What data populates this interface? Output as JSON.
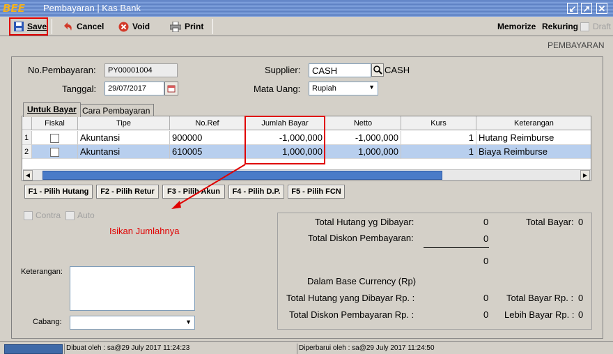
{
  "window": {
    "logo": "BEE",
    "title": "Pembayaran | Kas Bank"
  },
  "toolbar": {
    "save": "Save",
    "cancel": "Cancel",
    "void": "Void",
    "print": "Print",
    "memorize": "Memorize",
    "rekuring": "Rekuring",
    "draft": "Draft"
  },
  "form": {
    "heading": "PEMBAYARAN",
    "no_pembayaran_label": "No.Pembayaran:",
    "no_pembayaran_value": "PY00001004",
    "tanggal_label": "Tanggal:",
    "tanggal_value": "29/07/2017",
    "supplier_label": "Supplier:",
    "supplier_value": "CASH",
    "supplier_name": "CASH",
    "mata_uang_label": "Mata Uang:",
    "mata_uang_value": "Rupiah"
  },
  "tabs": [
    "Untuk Bayar",
    "Cara Pembayaran"
  ],
  "grid": {
    "columns": [
      "Fiskal",
      "Tipe",
      "No.Ref",
      "Jumlah Bayar",
      "Netto",
      "Kurs",
      "Keterangan"
    ],
    "rows": [
      {
        "no": "1",
        "fiskal": false,
        "tipe": "Akuntansi",
        "noref": "900000",
        "jumlah": "-1,000,000",
        "netto": "-1,000,000",
        "kurs": "1",
        "keterangan": "Hutang Reimburse"
      },
      {
        "no": "2",
        "fiskal": false,
        "tipe": "Akuntansi",
        "noref": "610005",
        "jumlah": "1,000,000",
        "netto": "1,000,000",
        "kurs": "1",
        "keterangan": "Biaya Reimburse"
      }
    ]
  },
  "fkeys": [
    "F1 - Pilih Hutang",
    "F2 - Pilih Retur",
    "F3 - Pilih Akun",
    "F4 - Pilih D.P.",
    "F5 - Pilih FCN"
  ],
  "options": {
    "contra": "Contra",
    "auto": "Auto"
  },
  "annotation": "Isikan Jumlahnya",
  "notes": {
    "keterangan_label": "Keterangan:",
    "cabang_label": "Cabang:"
  },
  "totals": {
    "total_hutang_label": "Total Hutang yg Dibayar:",
    "total_hutang_value": "0",
    "total_bayar_label": "Total Bayar:",
    "total_bayar_value": "0",
    "total_diskon_label": "Total Diskon Pembayaran:",
    "total_diskon_value": "0",
    "subtotal_value": "0",
    "base_currency_label": "Dalam Base Currency (Rp)",
    "total_hutang_rp_label": "Total Hutang yang Dibayar Rp. :",
    "total_hutang_rp_value": "0",
    "total_bayar_rp_label": "Total Bayar Rp. :",
    "total_bayar_rp_value": "0",
    "total_diskon_rp_label": "Total Diskon Pembayaran Rp. :",
    "total_diskon_rp_value": "0",
    "lebih_bayar_rp_label": "Lebih Bayar Rp. :",
    "lebih_bayar_rp_value": "0"
  },
  "status": {
    "created": "Dibuat oleh : sa@29 July 2017  11:24:23",
    "updated": "Diperbarui oleh : sa@29 July 2017  11:24:50"
  },
  "colors": {
    "highlight": "#e00000",
    "titlebar": "#6b8fcf",
    "selected_row": "#b8cfee"
  }
}
